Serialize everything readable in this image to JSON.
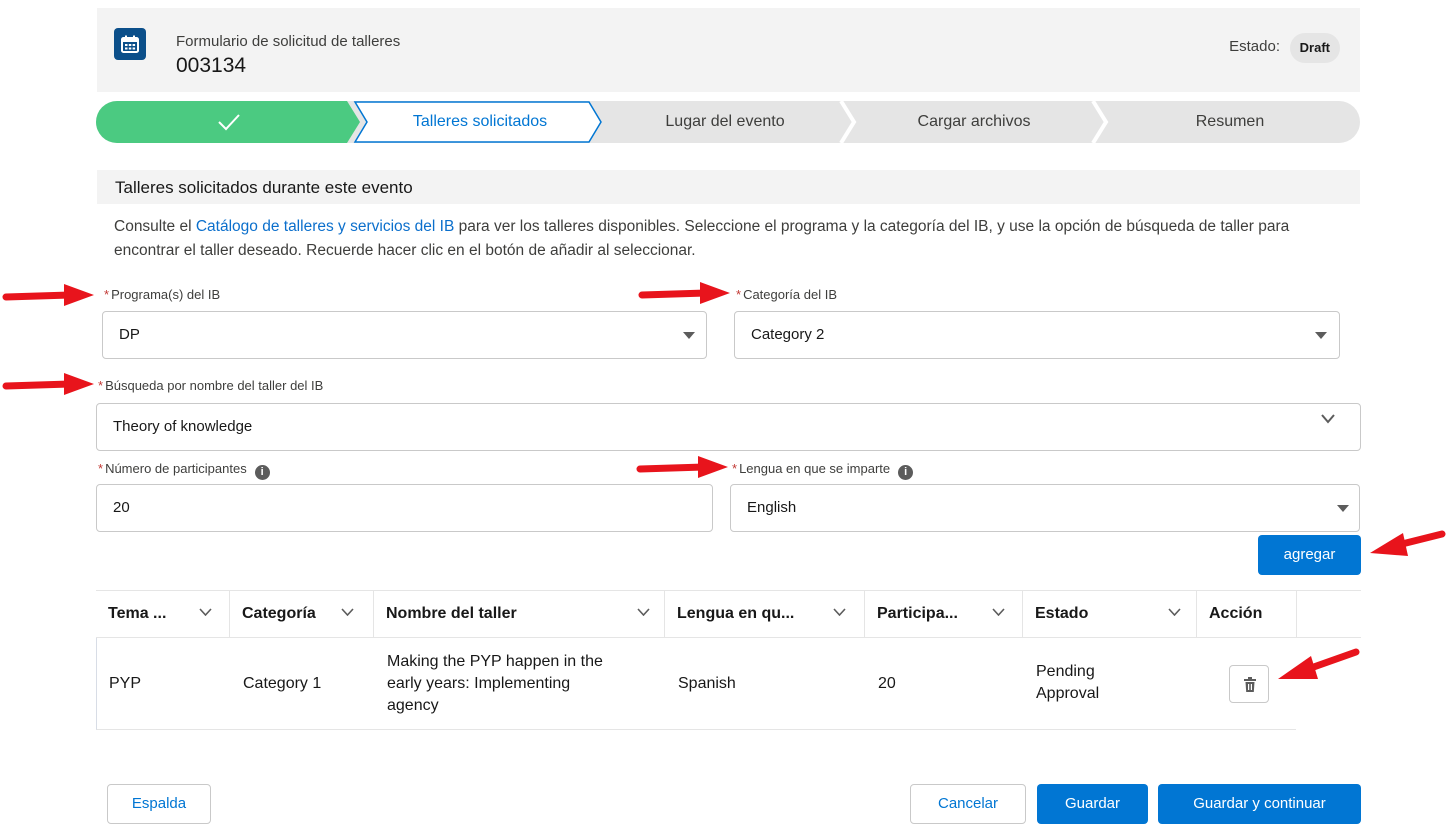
{
  "header": {
    "subtitle": "Formulario de solicitud de talleres",
    "record_number": "003134",
    "status_label": "Estado:",
    "status_value": "Draft",
    "icon": "calendar-icon"
  },
  "path": {
    "steps": [
      {
        "label": "",
        "state": "complete"
      },
      {
        "label": "Talleres solicitados",
        "state": "current"
      },
      {
        "label": "Lugar del evento",
        "state": "incomplete"
      },
      {
        "label": "Cargar archivos",
        "state": "incomplete"
      },
      {
        "label": "Resumen",
        "state": "incomplete"
      }
    ],
    "colors": {
      "complete": "#4bca81",
      "incomplete": "#e5e5e5",
      "current_border": "#0176d3"
    }
  },
  "section": {
    "title": "Talleres solicitados durante este evento",
    "intro_before_link": "Consulte el ",
    "intro_link": "Catálogo de talleres y servicios del IB",
    "intro_after_link": " para ver los talleres disponibles. Seleccione el programa y la categoría del IB, y use la opción de búsqueda de taller para encontrar el taller deseado. Recuerde hacer clic en el botón de añadir al seleccionar."
  },
  "form": {
    "required_marker": "*",
    "programa": {
      "label": "Programa(s) del IB",
      "value": "DP"
    },
    "categoria": {
      "label": "Categoría del IB",
      "value": "Category 2"
    },
    "busqueda": {
      "label": "Búsqueda por nombre del taller del IB",
      "value": "Theory of knowledge"
    },
    "participantes": {
      "label": "Número de participantes",
      "value": "20"
    },
    "lengua": {
      "label": "Lengua en que se imparte",
      "value": "English"
    },
    "info_glyph": "i",
    "add_button": "agregar"
  },
  "table": {
    "columns": [
      "Tema ...",
      "Categoría",
      "Nombre del taller",
      "Lengua en qu...",
      "Participa...",
      "Estado",
      "Acción"
    ],
    "rows": [
      {
        "tema": "PYP",
        "categoria": "Category 1",
        "nombre_line1": "Making the PYP happen in the",
        "nombre_line2": "early years: Implementing",
        "nombre_line3": "agency",
        "lengua": "Spanish",
        "participantes": "20",
        "estado_line1": "Pending",
        "estado_line2": "Approval"
      }
    ]
  },
  "footer": {
    "back": "Espalda",
    "cancel": "Cancelar",
    "save": "Guardar",
    "save_continue": "Guardar y continuar"
  },
  "colors": {
    "brand": "#0176d3",
    "annotation_arrow": "#e8141c"
  }
}
